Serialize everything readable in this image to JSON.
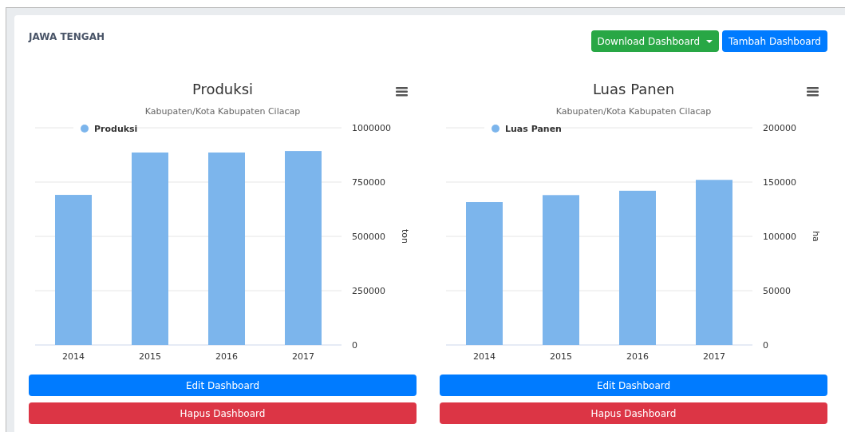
{
  "header": {
    "title": "JAWA TENGAH",
    "buttons": [
      {
        "label": "Download Dashboard",
        "kind": "dropdown"
      },
      {
        "label": "Tambah Dashboard",
        "kind": "primary"
      }
    ]
  },
  "panels": [
    {
      "chart_data": {
        "type": "bar",
        "title": "Produksi",
        "subtitle": "Kabupaten/Kota Kabupaten Cilacap",
        "ylabel": "ton",
        "categories": [
          "2014",
          "2015",
          "2016",
          "2017"
        ],
        "series": [
          {
            "name": "Produksi",
            "color": "#7cb5ec",
            "values": [
              691000,
              886000,
              886000,
              893000
            ]
          }
        ],
        "ylim": [
          0,
          1000000
        ],
        "yticks": [
          0,
          250000,
          500000,
          750000,
          1000000
        ],
        "grid": true
      },
      "buttons": [
        {
          "label": "Edit Dashboard",
          "kind": "edit"
        },
        {
          "label": "Hapus Dashboard",
          "kind": "delete"
        }
      ]
    },
    {
      "chart_data": {
        "type": "bar",
        "title": "Luas Panen",
        "subtitle": "Kabupaten/Kota Kabupaten Cilacap",
        "ylabel": "ha",
        "categories": [
          "2014",
          "2015",
          "2016",
          "2017"
        ],
        "series": [
          {
            "name": "Luas Panen",
            "color": "#7cb5ec",
            "values": [
              131600,
              138000,
              142000,
              152000
            ]
          }
        ],
        "ylim": [
          0,
          200000
        ],
        "yticks": [
          0,
          50000,
          100000,
          150000,
          200000
        ],
        "grid": true
      },
      "buttons": [
        {
          "label": "Edit Dashboard",
          "kind": "edit"
        },
        {
          "label": "Hapus Dashboard",
          "kind": "delete"
        }
      ]
    }
  ]
}
